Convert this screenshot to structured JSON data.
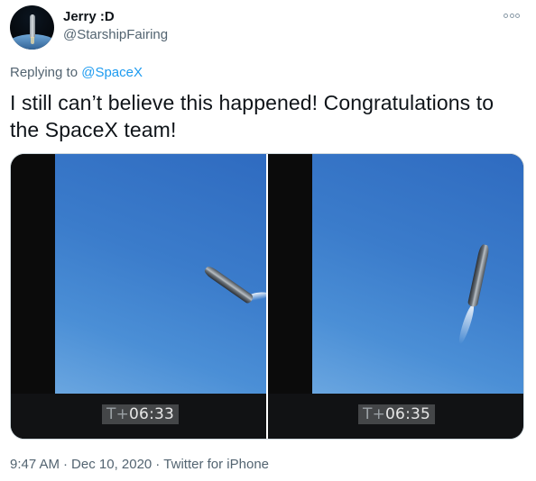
{
  "tweet": {
    "author": {
      "display_name": "Jerry :D",
      "handle": "@StarshipFairing"
    },
    "more_icon": "more-options-icon",
    "reply_prefix": "Replying to",
    "reply_to": "@SpaceX",
    "text": "I still can’t believe this happened! Congratulations to the SpaceX team!",
    "media": [
      {
        "timecode_prefix": "T+",
        "timecode": "06:33"
      },
      {
        "timecode_prefix": "T+",
        "timecode": "06:35"
      }
    ],
    "footer": {
      "time": "9:47 AM",
      "date": "Dec 10, 2020",
      "source": "Twitter for iPhone",
      "separator": "·"
    }
  },
  "colors": {
    "link": "#1d9bf0",
    "secondary_text": "#536471",
    "sky": "#3b7ccb"
  }
}
